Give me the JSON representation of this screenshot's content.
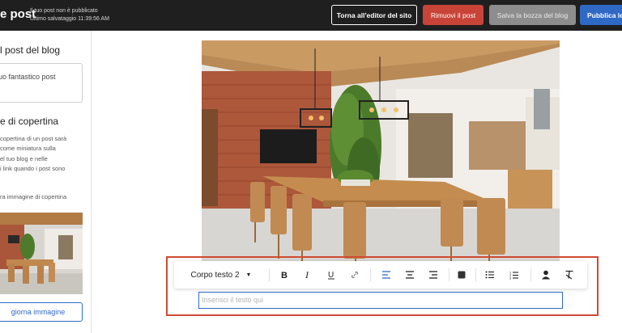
{
  "topbar": {
    "title": "e post",
    "status_line1": "Il tuo post non è pubblicato",
    "status_line2": "Ultimo salvataggio 11:39:56 AM",
    "back_button": "Torna all'editor del sito",
    "remove_button": "Rimuovi il post",
    "draft_button": "Salva la bozza del blog",
    "publish_button": "Pubblica le"
  },
  "sidebar": {
    "title_heading": "l post del blog",
    "title_value": "uo fantastico post",
    "cover_heading": "e di copertina",
    "cover_description": [
      "copertina di un post sarà",
      "come miniatura sulla",
      "el tuo blog e nelle",
      "i link quando i post sono"
    ],
    "cover_label": "ra immagine di copertina",
    "update_button": "giorna immagine"
  },
  "editor": {
    "text_style": "Corpo testo 2",
    "placeholder": "Inserisci il testo qui",
    "toolbar_icons": [
      "bold-icon",
      "italic-icon",
      "underline-icon",
      "link-icon",
      "align-left-icon",
      "align-center-icon",
      "align-right-icon",
      "color-swatch-icon",
      "bullet-list-icon",
      "numbered-list-icon",
      "person-icon",
      "clear-format-icon"
    ]
  },
  "colors": {
    "topbar_bg": "#1f1f1f",
    "remove_red": "#c94438",
    "draft_gray": "#8d8d8d",
    "publish_blue": "#2f69c6",
    "highlight_frame": "#d04a32"
  }
}
